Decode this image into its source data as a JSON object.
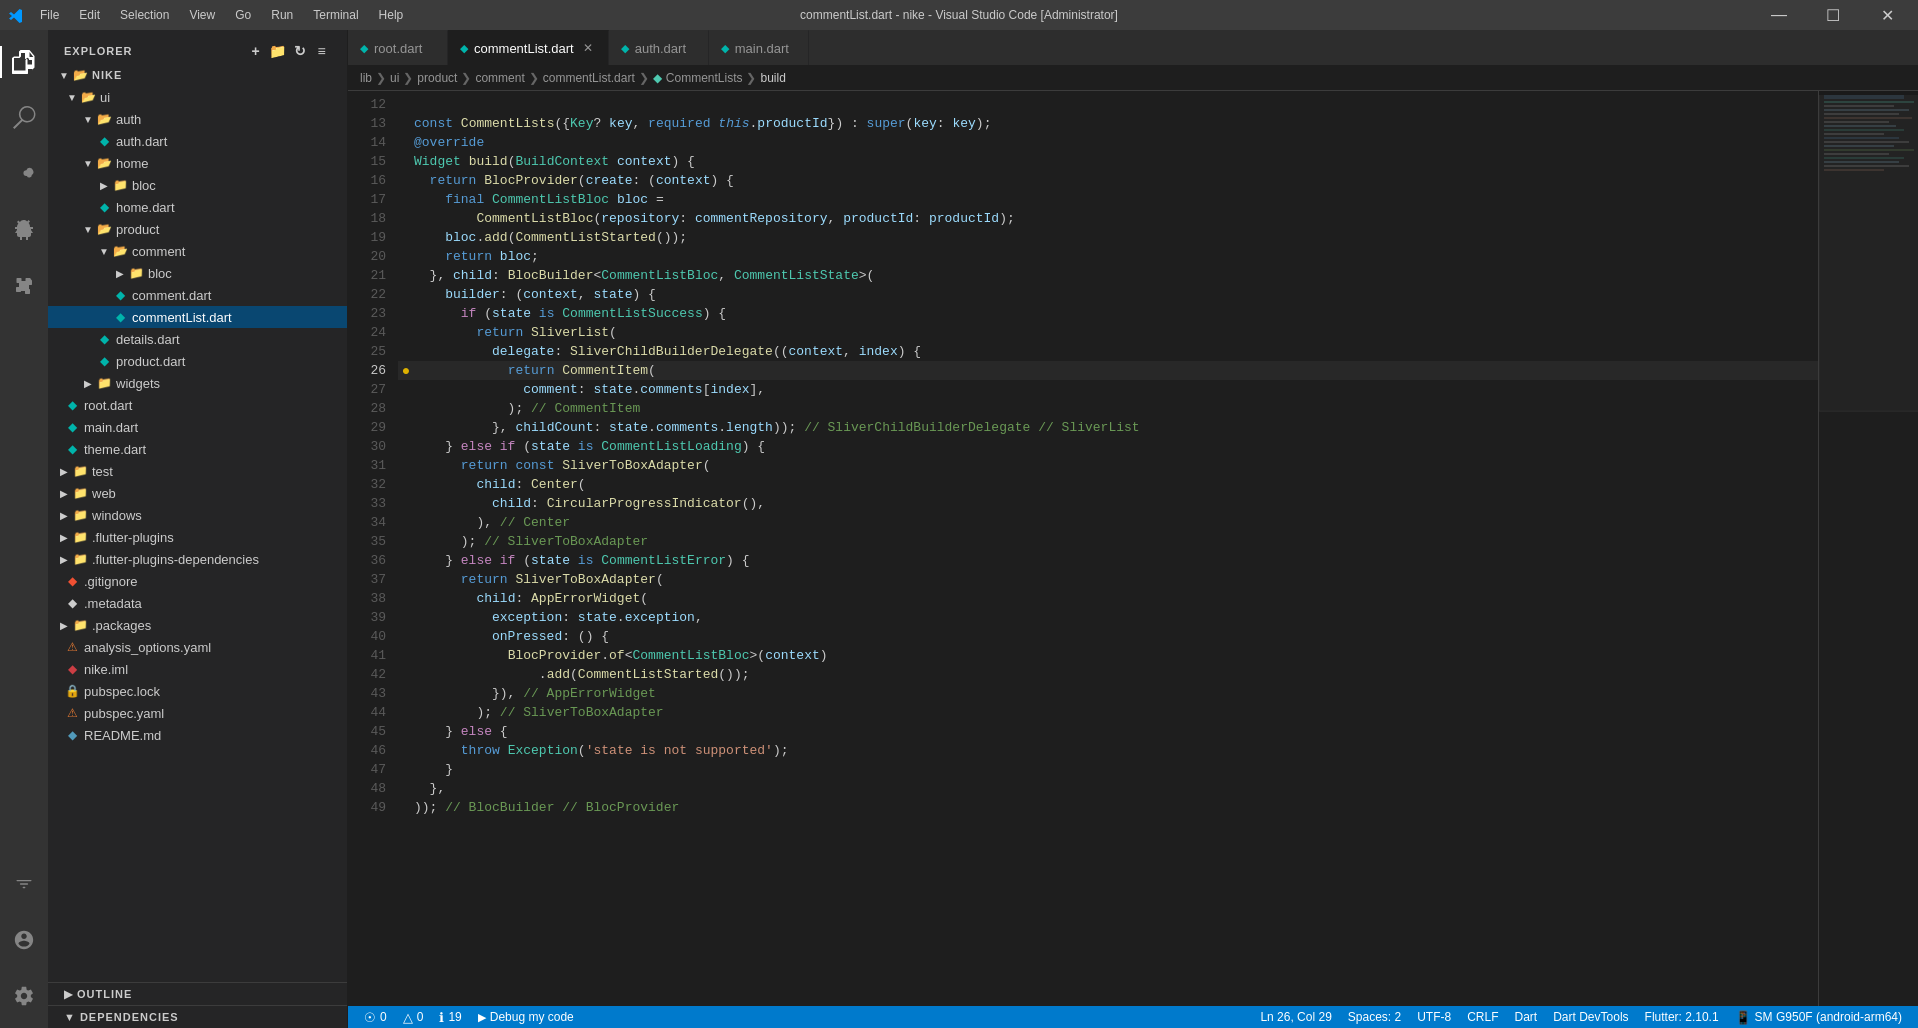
{
  "titleBar": {
    "title": "commentList.dart - nike - Visual Studio Code [Administrator]",
    "menus": [
      "File",
      "Edit",
      "Selection",
      "View",
      "Go",
      "Run",
      "Terminal",
      "Help"
    ],
    "windowControls": [
      "minimize",
      "maximize",
      "close"
    ]
  },
  "tabs": [
    {
      "id": "root",
      "label": "root.dart",
      "icon": "dart",
      "active": false,
      "modified": false,
      "dirty": false
    },
    {
      "id": "commentList",
      "label": "commentList.dart",
      "icon": "dart",
      "active": true,
      "modified": true,
      "dirty": true
    },
    {
      "id": "auth",
      "label": "auth.dart",
      "icon": "dart",
      "active": false,
      "modified": false,
      "dirty": false
    },
    {
      "id": "main",
      "label": "main.dart",
      "icon": "dart",
      "active": false,
      "modified": false,
      "dirty": false
    }
  ],
  "breadcrumb": {
    "items": [
      "lib",
      "ui",
      "product",
      "comment",
      "commentList.dart",
      "CommentLists",
      "build"
    ]
  },
  "sidebar": {
    "title": "EXPLORER",
    "projectName": "NIKE",
    "tree": [
      {
        "level": 1,
        "type": "folder",
        "label": "ui",
        "expanded": true
      },
      {
        "level": 2,
        "type": "folder",
        "label": "auth",
        "expanded": true
      },
      {
        "level": 3,
        "type": "file-dart",
        "label": "auth.dart"
      },
      {
        "level": 2,
        "type": "folder",
        "label": "home",
        "expanded": true
      },
      {
        "level": 3,
        "type": "folder",
        "label": "bloc",
        "expanded": false
      },
      {
        "level": 3,
        "type": "file-dart",
        "label": "home.dart"
      },
      {
        "level": 2,
        "type": "folder",
        "label": "product",
        "expanded": true
      },
      {
        "level": 3,
        "type": "folder",
        "label": "comment",
        "expanded": true
      },
      {
        "level": 4,
        "type": "folder",
        "label": "bloc",
        "expanded": false
      },
      {
        "level": 4,
        "type": "file-dart",
        "label": "comment.dart"
      },
      {
        "level": 4,
        "type": "file-dart-active",
        "label": "commentList.dart"
      },
      {
        "level": 3,
        "type": "file-dart",
        "label": "details.dart"
      },
      {
        "level": 3,
        "type": "file-dart",
        "label": "product.dart"
      },
      {
        "level": 2,
        "type": "folder",
        "label": "widgets",
        "expanded": false
      },
      {
        "level": 1,
        "type": "file-dart",
        "label": "root.dart"
      },
      {
        "level": 1,
        "type": "file-dart",
        "label": "main.dart"
      },
      {
        "level": 1,
        "type": "file-dart",
        "label": "theme.dart"
      },
      {
        "level": 0,
        "type": "folder",
        "label": "test",
        "expanded": false
      },
      {
        "level": 0,
        "type": "folder",
        "label": "web",
        "expanded": false
      },
      {
        "level": 0,
        "type": "folder",
        "label": "windows",
        "expanded": false
      },
      {
        "level": 0,
        "type": "folder",
        "label": ".flutter-plugins",
        "expanded": false
      },
      {
        "level": 0,
        "type": "folder",
        "label": ".flutter-plugins-dependencies",
        "expanded": false
      },
      {
        "level": 0,
        "type": "file-gitignore",
        "label": ".gitignore"
      },
      {
        "level": 0,
        "type": "file-meta",
        "label": ".metadata"
      },
      {
        "level": 0,
        "type": "folder",
        "label": ".packages",
        "expanded": false
      },
      {
        "level": 0,
        "type": "file-yaml-warn",
        "label": "analysis_options.yaml"
      },
      {
        "level": 0,
        "type": "file-iml",
        "label": "nike.iml"
      },
      {
        "level": 0,
        "type": "file-lock",
        "label": "pubspec.lock"
      },
      {
        "level": 0,
        "type": "file-yaml",
        "label": "pubspec.yaml"
      },
      {
        "level": 0,
        "type": "file-md",
        "label": "README.md"
      }
    ],
    "sections": [
      {
        "label": "OUTLINE",
        "expanded": false
      },
      {
        "label": "DEPENDENCIES",
        "expanded": true
      }
    ]
  },
  "codeLines": [
    {
      "num": 12,
      "content": ""
    },
    {
      "num": 13,
      "content": "const CommentLists({Key? key, required this.productId}) : super(key: key);"
    },
    {
      "num": 14,
      "content": "@override"
    },
    {
      "num": 15,
      "content": "Widget build(BuildContext context) {"
    },
    {
      "num": 16,
      "content": "  return BlocProvider(create: (context) {"
    },
    {
      "num": 17,
      "content": "    final CommentListBloc bloc ="
    },
    {
      "num": 18,
      "content": "        CommentListBloc(repository: commentRepository, productId: productId);"
    },
    {
      "num": 19,
      "content": "    bloc.add(CommentListStarted());"
    },
    {
      "num": 20,
      "content": "    return bloc;"
    },
    {
      "num": 21,
      "content": "  }, child: BlocBuilder<CommentListBloc, CommentListState>("
    },
    {
      "num": 22,
      "content": "    builder: (context, state) {"
    },
    {
      "num": 23,
      "content": "      if (state is CommentListSuccess) {"
    },
    {
      "num": 24,
      "content": "        return SliverList("
    },
    {
      "num": 25,
      "content": "          delegate: SliverChildBuilderDelegate((context, index) {"
    },
    {
      "num": 26,
      "content": "            return CommentItem(",
      "hasBullet": true
    },
    {
      "num": 27,
      "content": "              comment: state.comments[index],"
    },
    {
      "num": 28,
      "content": "            ); // CommentItem"
    },
    {
      "num": 29,
      "content": "          }, childCount: state.comments.length)); // SliverChildBuilderDelegate // SliverList"
    },
    {
      "num": 30,
      "content": "    } else if (state is CommentListLoading) {"
    },
    {
      "num": 31,
      "content": "      return const SliverToBoxAdapter("
    },
    {
      "num": 32,
      "content": "        child: Center("
    },
    {
      "num": 33,
      "content": "          child: CircularProgressIndicator(),"
    },
    {
      "num": 34,
      "content": "        ), // Center"
    },
    {
      "num": 35,
      "content": "      ); // SliverToBoxAdapter"
    },
    {
      "num": 36,
      "content": "    } else if (state is CommentListError) {"
    },
    {
      "num": 37,
      "content": "      return SliverToBoxAdapter("
    },
    {
      "num": 38,
      "content": "        child: AppErrorWidget("
    },
    {
      "num": 39,
      "content": "          exception: state.exception,"
    },
    {
      "num": 40,
      "content": "          onPressed: () {"
    },
    {
      "num": 41,
      "content": "            BlocProvider.of<CommentListBloc>(context)"
    },
    {
      "num": 42,
      "content": "                .add(CommentListStarted());"
    },
    {
      "num": 43,
      "content": "          }), // AppErrorWidget"
    },
    {
      "num": 44,
      "content": "        ); // SliverToBoxAdapter"
    },
    {
      "num": 45,
      "content": "    } else {"
    },
    {
      "num": 46,
      "content": "      throw Exception('state is not supported');"
    },
    {
      "num": 47,
      "content": "    }"
    },
    {
      "num": 48,
      "content": "  },"
    },
    {
      "num": 49,
      "content": ")); // BlocBuilder // BlocProvider"
    }
  ],
  "statusBar": {
    "left": [
      {
        "icon": "error",
        "text": "0"
      },
      {
        "icon": "warning",
        "text": "0"
      },
      {
        "icon": "info",
        "text": "19"
      },
      {
        "text": "Debug my code"
      }
    ],
    "right": [
      {
        "text": "Ln 26, Col 29"
      },
      {
        "text": "Spaces: 2"
      },
      {
        "text": "UTF-8"
      },
      {
        "text": "CRLF"
      },
      {
        "text": "Dart"
      },
      {
        "text": "Dart DevTools"
      },
      {
        "text": "Flutter: 2.10.1"
      },
      {
        "text": "SM G950F (android-arm64)"
      }
    ]
  }
}
